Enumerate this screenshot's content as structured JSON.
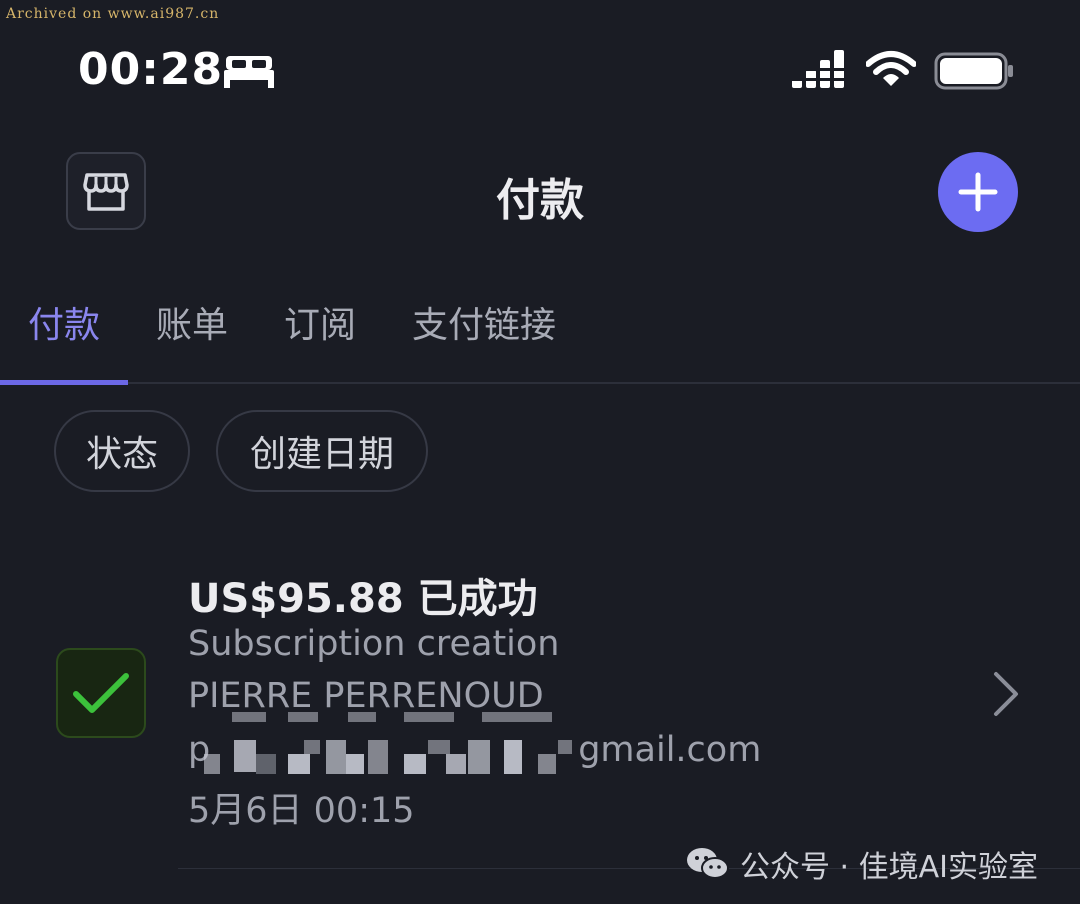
{
  "archive_label": "Archived on www.ai987.cn",
  "status_bar": {
    "time": "00:28",
    "icons": [
      "bed-icon",
      "signal-icon",
      "wifi-icon",
      "battery-icon"
    ]
  },
  "header": {
    "title": "付款",
    "left_icon": "storefront-icon",
    "right_icon": "plus-icon"
  },
  "tabs": [
    {
      "label": "付款",
      "active": true
    },
    {
      "label": "账单",
      "active": false
    },
    {
      "label": "订阅",
      "active": false
    },
    {
      "label": "支付链接",
      "active": false
    }
  ],
  "filters": [
    {
      "label": "状态"
    },
    {
      "label": "创建日期"
    }
  ],
  "payment": {
    "amount_status": "US$95.88 已成功",
    "description": "Subscription creation",
    "customer_name": "PIERRE PERRENOUD",
    "email_prefix": "p",
    "email_suffix": "gmail.com",
    "date": "5月6日 00:15",
    "status_icon": "checkmark-icon"
  },
  "watermark": {
    "text": "公众号 · 佳境AI实验室",
    "icon": "wechat-icon"
  },
  "colors": {
    "background": "#1a1c24",
    "accent": "#6c6cf2",
    "active_tab": "#8a86ee",
    "success": "#3cc13b"
  }
}
